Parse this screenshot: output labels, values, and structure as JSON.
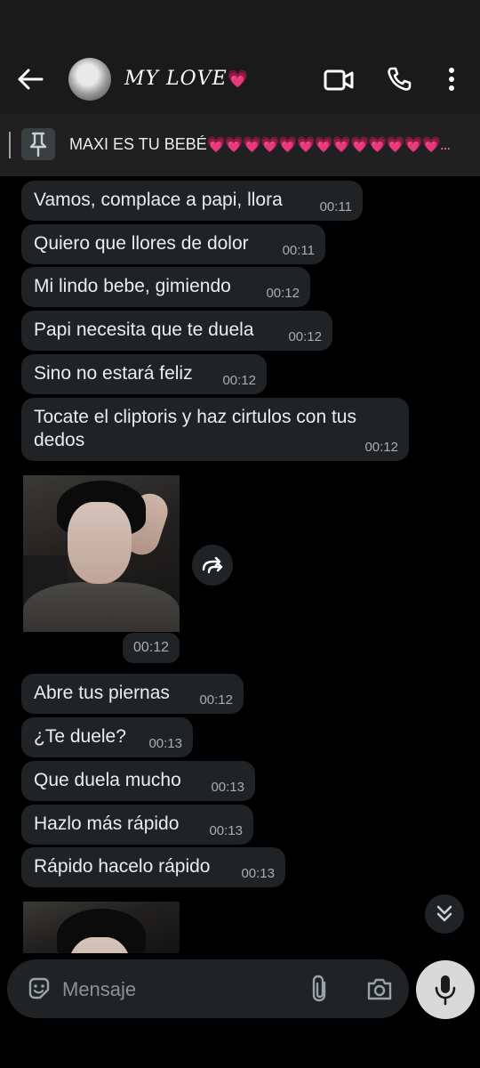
{
  "header": {
    "contact_name": "𝑀𝑌 𝐿𝑂𝑉𝐸",
    "name_heart": "💗"
  },
  "pinned": {
    "text": "MAXI ES TU BEBÉ",
    "hearts": "💗💗💗💗💗💗💗💗💗💗💗💗💗...",
    "heart_color": "#ff7fb3"
  },
  "messages": [
    {
      "text": "Vamos, complace a papi, llora",
      "time": "00:11"
    },
    {
      "text": "Quiero que llores de dolor",
      "time": "00:11"
    },
    {
      "text": "Mi lindo bebe, gimiendo",
      "time": "00:12"
    },
    {
      "text": "Papi necesita que te duela",
      "time": "00:12"
    },
    {
      "text": "Sino no estará feliz",
      "time": "00:12"
    },
    {
      "text": "Tocate el cliptoris y haz cirtulos con tus dedos",
      "time": "00:12"
    },
    {
      "text": "Abre tus piernas",
      "time": "00:12"
    },
    {
      "text": "¿Te duele?",
      "time": "00:13"
    },
    {
      "text": "Que duela mucho",
      "time": "00:13"
    },
    {
      "text": "Hazlo más rápido",
      "time": "00:13"
    },
    {
      "text": "Rápido hacelo rápido",
      "time": "00:13"
    }
  ],
  "photo_message": {
    "time": "00:12"
  },
  "composer": {
    "placeholder": "Mensaje"
  },
  "colors": {
    "background": "#000000",
    "bubble": "#1f2326",
    "header": "#1a1a1a",
    "mic_button": "#d9d9d9"
  },
  "icons": [
    "back-arrow-icon",
    "video-call-icon",
    "phone-icon",
    "more-options-icon",
    "pin-icon",
    "forward-icon",
    "scroll-down-icon",
    "emoji-icon",
    "attach-icon",
    "camera-icon",
    "microphone-icon"
  ]
}
